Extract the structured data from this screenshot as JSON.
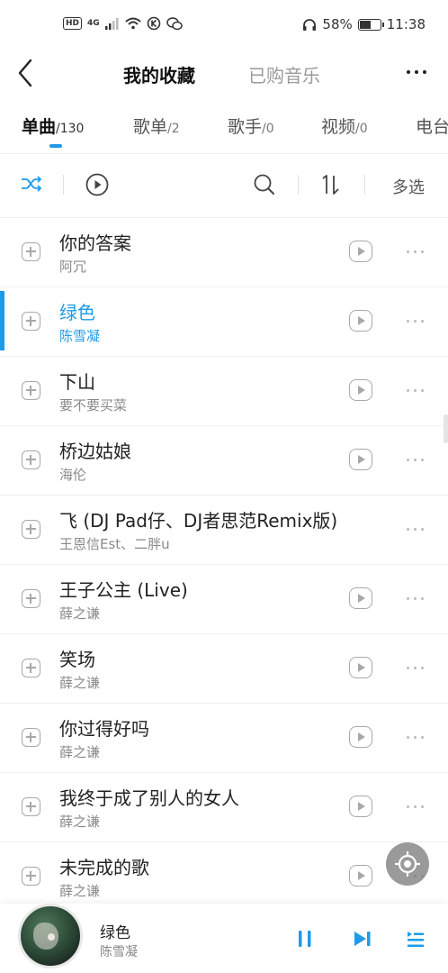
{
  "status_bar": {
    "badge": "HD",
    "network": "4G",
    "battery": "58%",
    "battery_level": 0.58,
    "time": "11:38"
  },
  "header": {
    "title": "我的收藏",
    "secondary_title": "已购音乐"
  },
  "tabs": [
    {
      "label": "单曲",
      "count": "/130"
    },
    {
      "label": "歌单",
      "count": "/2"
    },
    {
      "label": "歌手",
      "count": "/0"
    },
    {
      "label": "视频",
      "count": "/0"
    },
    {
      "label": "电台",
      "count": ""
    }
  ],
  "toolbar": {
    "multi_select_label": "多选"
  },
  "songs": [
    {
      "title": "你的答案",
      "artist": "阿冗"
    },
    {
      "title": "绿色",
      "artist": "陈雪凝"
    },
    {
      "title": "下山",
      "artist": "要不要买菜"
    },
    {
      "title": "桥边姑娘",
      "artist": "海伦"
    },
    {
      "title": "飞 (DJ Pad仔、DJ者思范Remix版)",
      "artist": "王恩信Est、二胖u"
    },
    {
      "title": "王子公主 (Live)",
      "artist": "薛之谦"
    },
    {
      "title": "笑场",
      "artist": "薛之谦"
    },
    {
      "title": "你过得好吗",
      "artist": "薛之谦"
    },
    {
      "title": "我终于成了别人的女人",
      "artist": "薛之谦"
    },
    {
      "title": "未完成的歌",
      "artist": "薛之谦"
    }
  ],
  "now_playing": {
    "title": "绿色",
    "artist": "陈雪凝"
  },
  "colors": {
    "accent": "#1e9be8",
    "icon_gray": "#a8a8a8"
  }
}
